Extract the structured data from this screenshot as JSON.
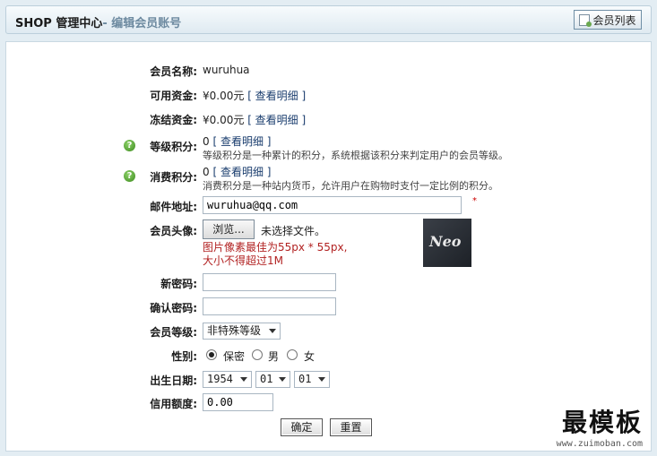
{
  "header": {
    "title": "SHOP 管理中心",
    "subtitle": "- 编辑会员账号",
    "list_button": "会员列表"
  },
  "form": {
    "username": {
      "label": "会员名称:",
      "value": "wuruhua"
    },
    "available_funds": {
      "label": "可用资金:",
      "value": "¥0.00元",
      "link": "[ 查看明细 ]"
    },
    "frozen_funds": {
      "label": "冻结资金:",
      "value": "¥0.00元",
      "link": "[ 查看明细 ]"
    },
    "rank_points": {
      "label": "等级积分:",
      "value": "0",
      "link": "[ 查看明细 ]",
      "note": "等级积分是一种累计的积分，系统根据该积分来判定用户的会员等级。"
    },
    "pay_points": {
      "label": "消费积分:",
      "value": "0",
      "link": "[ 查看明细 ]",
      "note": "消费积分是一种站内货币，允许用户在购物时支付一定比例的积分。"
    },
    "email": {
      "label": "邮件地址:",
      "value": "wuruhua@qq.com",
      "required_mark": "*"
    },
    "avatar": {
      "label": "会员头像:",
      "browse_button": "浏览...",
      "file_status": "未选择文件。",
      "hint_line1": "图片像素最佳为55px * 55px,",
      "hint_line2": "大小不得超过1M",
      "avatar_text": "Neo"
    },
    "new_password": {
      "label": "新密码:",
      "value": ""
    },
    "confirm_password": {
      "label": "确认密码:",
      "value": ""
    },
    "rank": {
      "label": "会员等级:",
      "selected": "非特殊等级"
    },
    "gender": {
      "label": "性别:",
      "options": [
        "保密",
        "男",
        "女"
      ],
      "selected": "保密"
    },
    "birthday": {
      "label": "出生日期:",
      "year": "1954",
      "month": "01",
      "day": "01"
    },
    "credit": {
      "label": "信用额度:",
      "value": "0.00"
    },
    "submit_button": "确定",
    "reset_button": "重置",
    "help_icon_glyph": "?"
  },
  "watermark": {
    "big": "最模板",
    "small": "www.zuimoban.com"
  }
}
